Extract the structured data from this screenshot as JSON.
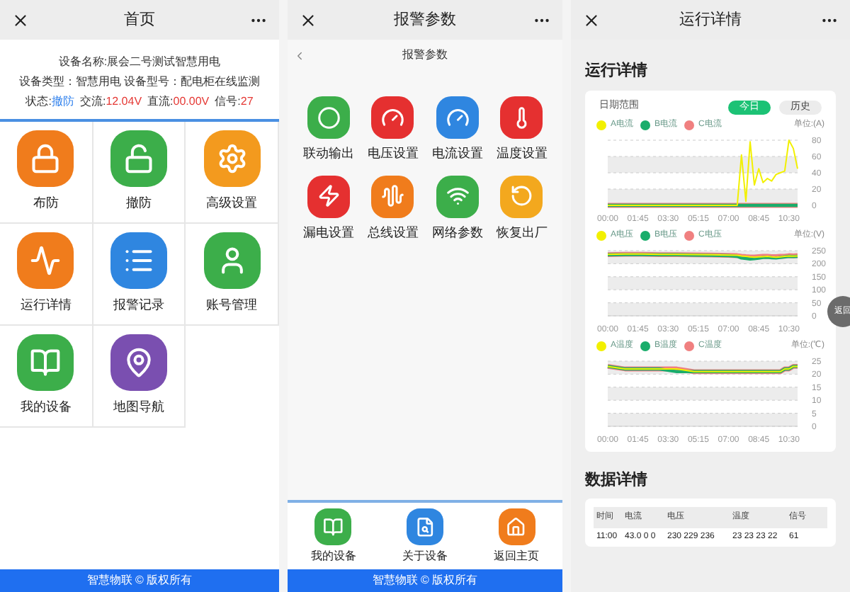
{
  "home": {
    "title": "首页",
    "device_name": "设备名称:展会二号测试智慧用电",
    "device_type": "设备类型：智慧用电 设备型号：配电柜在线监测",
    "status": [
      {
        "label": "状态:",
        "value": "撤防",
        "color": "#2f80ed"
      },
      {
        "label": "交流:",
        "value": "12.04V",
        "color": "#e53935"
      },
      {
        "label": "直流:",
        "value": "00.00V",
        "color": "#e53935"
      },
      {
        "label": "信号:",
        "value": "27",
        "color": "#e53935"
      }
    ],
    "menu": [
      {
        "label": "布防",
        "color": "#f07c1c"
      },
      {
        "label": "撤防",
        "color": "#3cae4a"
      },
      {
        "label": "高级设置",
        "color": "#f39a1e"
      },
      {
        "label": "运行详情",
        "color": "#f07c1c"
      },
      {
        "label": "报警记录",
        "color": "#2f86e0"
      },
      {
        "label": "账号管理",
        "color": "#3cae4a"
      },
      {
        "label": "我的设备",
        "color": "#3cae4a"
      },
      {
        "label": "地图导航",
        "color": "#7a4fb0"
      }
    ],
    "footer": "智慧物联 © 版权所有"
  },
  "alarm": {
    "title": "报警参数",
    "subtitle": "报警参数",
    "items": [
      {
        "label": "联动输出",
        "color": "#3cae4a"
      },
      {
        "label": "电压设置",
        "color": "#e53030"
      },
      {
        "label": "电流设置",
        "color": "#2f86e0"
      },
      {
        "label": "温度设置",
        "color": "#e53030"
      },
      {
        "label": "漏电设置",
        "color": "#e53030"
      },
      {
        "label": "总线设置",
        "color": "#f07c1c"
      },
      {
        "label": "网络参数",
        "color": "#3cae4a"
      },
      {
        "label": "恢复出厂",
        "color": "#f3a81e"
      }
    ],
    "bottom_nav": [
      {
        "label": "我的设备",
        "color": "#3cae4a"
      },
      {
        "label": "关于设备",
        "color": "#2f86e0"
      },
      {
        "label": "返回主页",
        "color": "#f07c1c"
      }
    ],
    "footer": "智慧物联 © 版权所有"
  },
  "details": {
    "title": "运行详情",
    "section_title": "运行详情",
    "date_range_label": "日期范围",
    "range_tabs": [
      {
        "label": "今日",
        "selected": true
      },
      {
        "label": "历史",
        "selected": false
      }
    ],
    "charts": [
      {
        "unit": "单位:(A)",
        "chart_data": {
          "type": "line",
          "x": [
            0,
            60,
            120,
            180,
            240,
            300,
            360,
            420,
            450,
            465,
            480,
            495,
            510,
            525,
            540,
            555,
            570,
            585,
            600,
            615,
            630,
            645,
            660
          ],
          "xticks": [
            {
              "value": 0,
              "label": "00:00"
            },
            {
              "value": 105,
              "label": "01:45"
            },
            {
              "value": 210,
              "label": "03:30"
            },
            {
              "value": 315,
              "label": "05:15"
            },
            {
              "value": 420,
              "label": "07:00"
            },
            {
              "value": 525,
              "label": "08:45"
            },
            {
              "value": 630,
              "label": "10:30"
            }
          ],
          "yticks": [
            0,
            20,
            40,
            60,
            80
          ],
          "ylim": [
            0,
            80
          ],
          "xlim": [
            0,
            660
          ],
          "grid": true,
          "series": [
            {
              "name": "A电流",
              "color": "#f2f000",
              "values": [
                0,
                0,
                0,
                0,
                0,
                0,
                0,
                0,
                0,
                62,
                5,
                78,
                25,
                45,
                28,
                33,
                30,
                38,
                40,
                42,
                80,
                70,
                45
              ]
            },
            {
              "name": "B电流",
              "color": "#1aad6b",
              "values": [
                0,
                0,
                0,
                0,
                0,
                0,
                0,
                0,
                0,
                0,
                0,
                0,
                0,
                0,
                0,
                0,
                0,
                0,
                0,
                0,
                0,
                0,
                0
              ]
            },
            {
              "name": "C电流",
              "color": "#f08080",
              "values": [
                0,
                0,
                0,
                0,
                0,
                0,
                0,
                0,
                0,
                0,
                0,
                0,
                0,
                0,
                0,
                0,
                0,
                0,
                0,
                0,
                0,
                0,
                0
              ]
            }
          ]
        }
      },
      {
        "unit": "单位:(V)",
        "chart_data": {
          "type": "line",
          "x": [
            0,
            60,
            120,
            180,
            240,
            300,
            360,
            420,
            450,
            465,
            480,
            495,
            510,
            525,
            540,
            555,
            570,
            585,
            600,
            615,
            630,
            645,
            660
          ],
          "xticks": [
            {
              "value": 0,
              "label": "00:00"
            },
            {
              "value": 105,
              "label": "01:45"
            },
            {
              "value": 210,
              "label": "03:30"
            },
            {
              "value": 315,
              "label": "05:15"
            },
            {
              "value": 420,
              "label": "07:00"
            },
            {
              "value": 525,
              "label": "08:45"
            },
            {
              "value": 630,
              "label": "10:30"
            }
          ],
          "yticks": [
            0,
            50,
            100,
            150,
            200,
            250
          ],
          "ylim": [
            0,
            250
          ],
          "xlim": [
            0,
            660
          ],
          "grid": true,
          "series": [
            {
              "name": "A电压",
              "color": "#f2f000",
              "values": [
                236,
                237,
                237,
                236,
                236,
                235,
                234,
                233,
                232,
                230,
                228,
                226,
                225,
                226,
                227,
                228,
                226,
                225,
                226,
                228,
                230,
                229,
                230
              ]
            },
            {
              "name": "B电压",
              "color": "#1aad6b",
              "values": [
                234,
                235,
                235,
                234,
                234,
                233,
                232,
                231,
                228,
                222,
                220,
                218,
                219,
                221,
                224,
                225,
                223,
                222,
                224,
                226,
                228,
                227,
                228
              ]
            },
            {
              "name": "C电压",
              "color": "#f08080",
              "values": [
                235,
                236,
                236,
                235,
                235,
                234,
                233,
                232,
                231,
                229,
                227,
                226,
                226,
                227,
                228,
                228,
                227,
                227,
                228,
                229,
                231,
                230,
                231
              ]
            }
          ]
        }
      },
      {
        "unit": "单位:(℃)",
        "chart_data": {
          "type": "line",
          "x": [
            0,
            60,
            120,
            180,
            240,
            300,
            360,
            420,
            450,
            465,
            480,
            495,
            510,
            525,
            540,
            555,
            570,
            585,
            600,
            615,
            630,
            645,
            660
          ],
          "xticks": [
            {
              "value": 0,
              "label": "00:00"
            },
            {
              "value": 105,
              "label": "01:45"
            },
            {
              "value": 210,
              "label": "03:30"
            },
            {
              "value": 315,
              "label": "05:15"
            },
            {
              "value": 420,
              "label": "07:00"
            },
            {
              "value": 525,
              "label": "08:45"
            },
            {
              "value": 630,
              "label": "10:30"
            }
          ],
          "yticks": [
            0,
            5,
            10,
            15,
            20,
            25
          ],
          "ylim": [
            0,
            25
          ],
          "xlim": [
            0,
            660
          ],
          "grid": true,
          "series": [
            {
              "name": "A温度",
              "color": "#f2f000",
              "values": [
                23,
                22,
                22,
                22,
                22,
                21,
                21,
                21,
                21,
                21,
                21,
                21,
                21,
                21,
                21,
                21,
                21,
                21,
                21,
                22,
                22,
                23,
                23
              ]
            },
            {
              "name": "B温度",
              "color": "#1aad6b",
              "values": [
                23,
                22,
                22,
                22,
                21,
                21,
                21,
                21,
                21,
                21,
                21,
                21,
                21,
                21,
                21,
                21,
                21,
                21,
                21,
                22,
                22,
                23,
                23
              ]
            },
            {
              "name": "C温度",
              "color": "#f08080",
              "values": [
                23,
                22,
                22,
                22,
                22,
                21,
                21,
                21,
                21,
                21,
                21,
                21,
                21,
                21,
                21,
                21,
                21,
                21,
                21,
                22,
                22,
                23,
                23
              ]
            }
          ]
        }
      }
    ],
    "float_button": "返回",
    "data_section_title": "数据详情",
    "table": {
      "columns": [
        "时间",
        "电流",
        "电压",
        "温度",
        "信号"
      ],
      "rows": [
        [
          "11:00",
          "43.0 0 0",
          "230 229 236",
          "23 23 23 22",
          "61"
        ]
      ]
    }
  }
}
